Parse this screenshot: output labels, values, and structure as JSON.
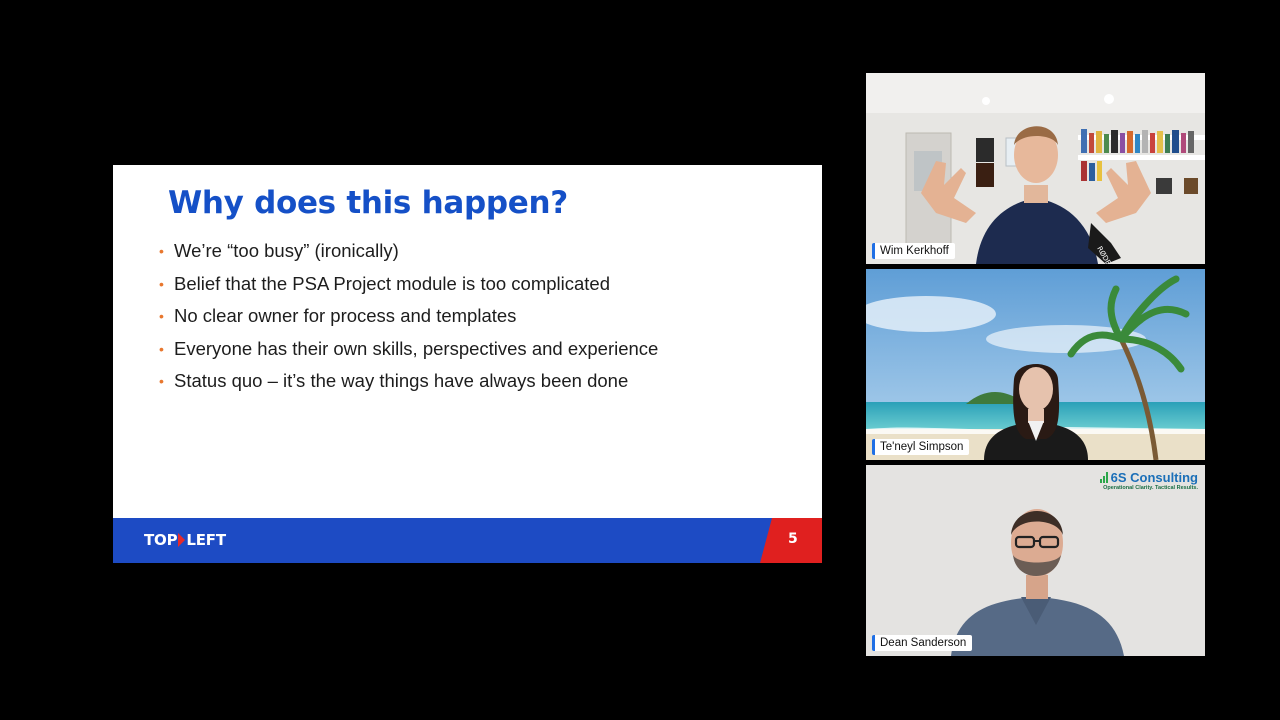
{
  "slide": {
    "title": "Why does this happen?",
    "bullets": [
      "We’re “too busy” (ironically)",
      "Belief that the PSA Project module is too complicated",
      "No clear owner for process and templates",
      "Everyone has their own skills, perspectives and experience",
      "Status quo – it’s the way things have always been done"
    ],
    "footer": {
      "logo_left": "TOP",
      "logo_right": "LEFT",
      "page_number": "5"
    }
  },
  "participants": [
    {
      "name": "Wim Kerkhoff",
      "background": "office-bookshelf"
    },
    {
      "name": "Te'neyl Simpson",
      "background": "tropical-beach"
    },
    {
      "name": "Dean Sanderson",
      "background": "plain-wall"
    }
  ],
  "branding": {
    "company": "6S Consulting",
    "tagline": "Operational Clarity. Tactical Results."
  },
  "colors": {
    "title_blue": "#1550c7",
    "bullet_orange": "#e8772e",
    "footer_blue": "#1d4bc4",
    "footer_red": "#e0201f",
    "name_tag_accent": "#1f6fe5"
  }
}
